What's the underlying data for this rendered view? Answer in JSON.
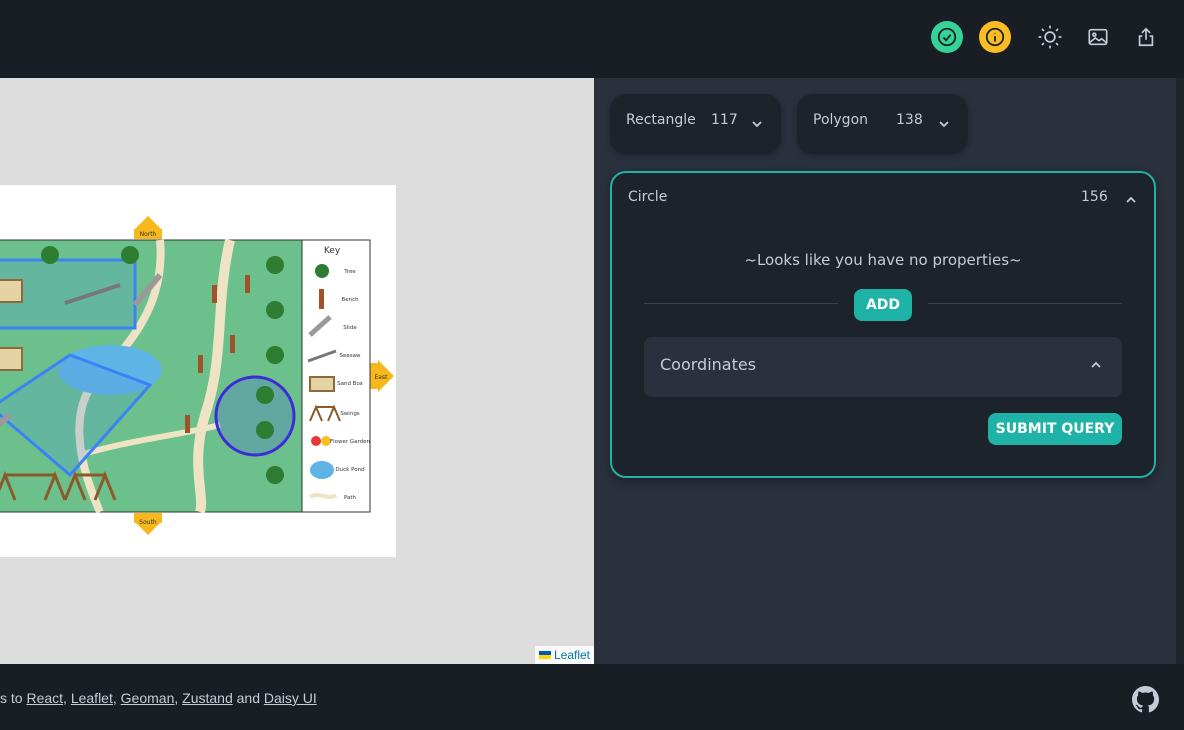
{
  "header": {
    "icons": [
      "check-icon",
      "info-icon",
      "sun-icon",
      "image-icon",
      "share-icon"
    ],
    "colors": {
      "success": "#36d399",
      "warning": "#fbbd23",
      "accent": "#1fb2a6"
    }
  },
  "map": {
    "compass": {
      "north": "North",
      "east": "East",
      "south": "South"
    },
    "key": {
      "title": "Key",
      "items": [
        "Tree",
        "Bench",
        "Slide",
        "Seesaw",
        "Sand Box",
        "Swings",
        "Flower Garden",
        "Duck Pond",
        "Path"
      ]
    },
    "attribution": "Leaflet"
  },
  "panel": {
    "rectangle": {
      "label": "Rectangle",
      "count": "117"
    },
    "polygon": {
      "label": "Polygon",
      "count": "138"
    },
    "circle": {
      "label": "Circle",
      "count": "156",
      "empty_message": "~Looks like you have no properties~",
      "add_label": "ADD",
      "coordinates_label": "Coordinates",
      "submit_label": "SUBMIT QUERY"
    }
  },
  "footer": {
    "prefix": "s to ",
    "links": [
      "React",
      "Leaflet",
      "Geoman",
      "Zustand",
      "Daisy UI"
    ],
    "sep1": ", ",
    "and": " and "
  }
}
